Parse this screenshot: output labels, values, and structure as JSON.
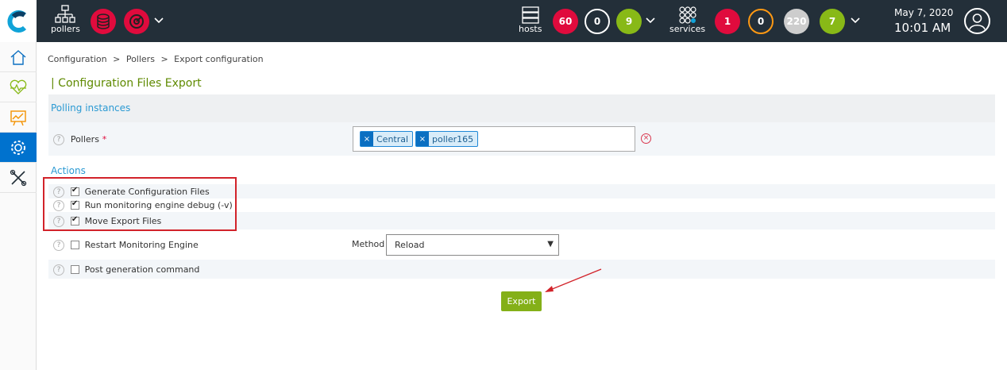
{
  "topbar": {
    "pollers_label": "pollers",
    "hosts_label": "hosts",
    "host_counts": [
      "60",
      "0",
      "9"
    ],
    "services_label": "services",
    "service_counts": [
      "1",
      "0",
      "220",
      "7"
    ],
    "date": "May 7, 2020",
    "time": "10:01 AM"
  },
  "breadcrumb": [
    "Configuration",
    ">",
    "Pollers",
    ">",
    "Export configuration"
  ],
  "page_title": "| Configuration Files Export",
  "sections": {
    "polling": "Polling instances",
    "actions": "Actions"
  },
  "pollers": {
    "label": "Pollers",
    "required": "*",
    "tags": [
      "Central",
      "poller165"
    ],
    "tag_remove": "×",
    "clear": "×"
  },
  "actions": [
    {
      "label": "Generate Configuration Files",
      "checked": true
    },
    {
      "label": "Run monitoring engine debug (-v)",
      "checked": true
    },
    {
      "label": "Move Export Files",
      "checked": true
    },
    {
      "label": "Restart Monitoring Engine",
      "checked": false
    },
    {
      "label": "Post generation command",
      "checked": false
    }
  ],
  "method": {
    "label": "Method",
    "value": "Reload",
    "caret": "▼"
  },
  "help": "?",
  "export_label": "Export",
  "colors": {
    "topbar": "#232f39",
    "accent_blue": "#0072ce",
    "green": "#84b018",
    "red": "#e00b3d"
  }
}
